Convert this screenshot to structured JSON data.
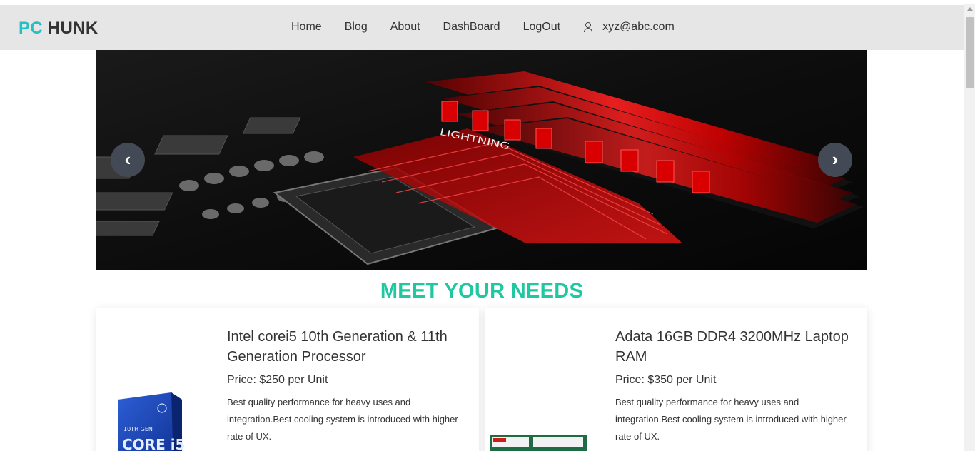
{
  "brand": {
    "part1": "PC",
    "part2": "HUNK"
  },
  "nav": {
    "links": [
      "Home",
      "Blog",
      "About",
      "DashBoard",
      "LogOut"
    ],
    "user_email": "xyz@abc.com"
  },
  "carousel": {
    "prev": "‹",
    "next": "›"
  },
  "section": {
    "title": "MEET YOUR NEEDS"
  },
  "products": [
    {
      "title": "Intel corei5 10th Generation & 11th Generation Processor",
      "price": "Price: $250 per Unit",
      "description": "Best quality performance for heavy uses and integration.Best cooling system is introduced with higher rate of UX."
    },
    {
      "title": "Adata 16GB DDR4 3200MHz Laptop RAM",
      "price": "Price: $350 per Unit",
      "description": "Best quality performance for heavy uses and integration.Best cooling system is introduced with higher rate of UX."
    }
  ],
  "colors": {
    "brand_accent": "#22c1c3",
    "heading": "#1fc8a0",
    "navbar_bg": "#e6e6e6",
    "carousel_btn": "#434a55"
  },
  "icons": {
    "user": "user-icon",
    "prev": "chevron-left-icon",
    "next": "chevron-right-icon"
  }
}
